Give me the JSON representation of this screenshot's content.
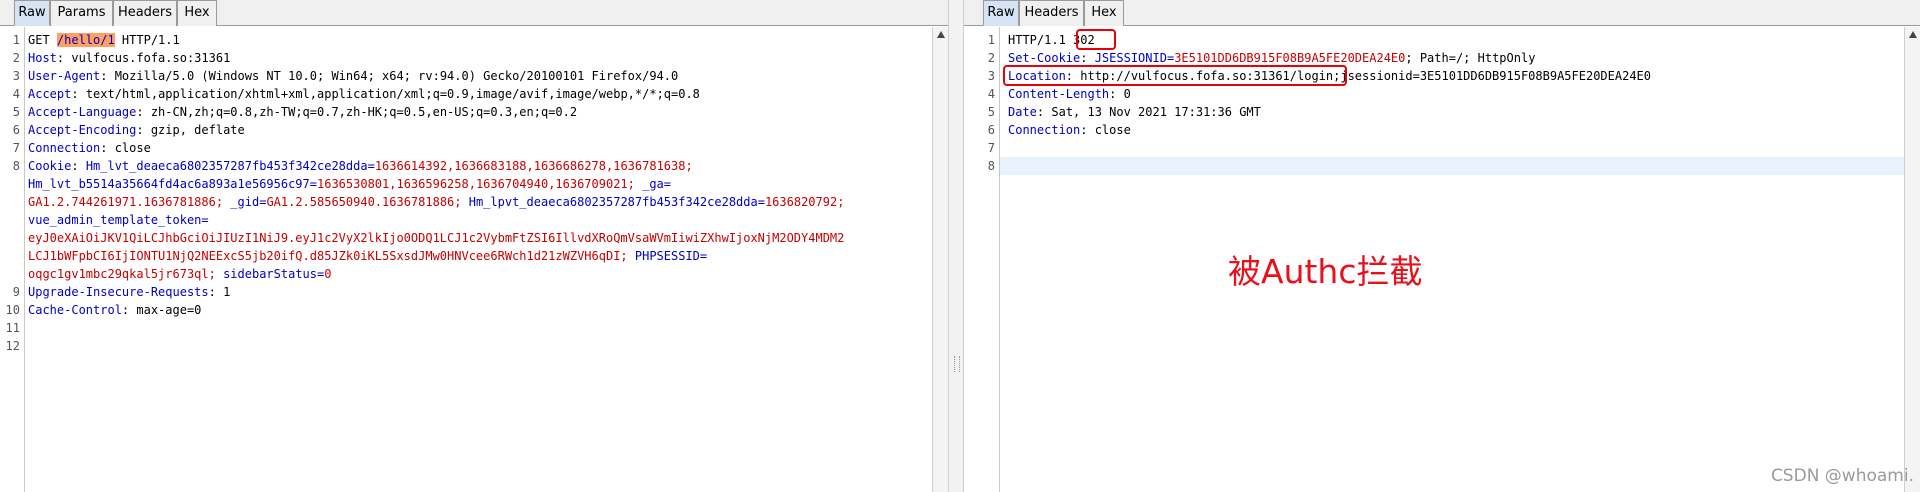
{
  "request": {
    "tabs": [
      "Raw",
      "Params",
      "Headers",
      "Hex"
    ],
    "line_numbers": [
      "1",
      "2",
      "3",
      "4",
      "5",
      "6",
      "7",
      "8",
      "",
      "",
      "",
      "",
      "",
      "",
      "9",
      "10",
      "11",
      "12"
    ],
    "line1": {
      "method": "GET ",
      "path": "/hello/1",
      "proto": " HTTP/1.1"
    },
    "headers": [
      {
        "k": "Host",
        "v": " vulfocus.fofa.so:31361"
      },
      {
        "k": "User-Agent",
        "v": " Mozilla/5.0 (Windows NT 10.0; Win64; x64; rv:94.0) Gecko/20100101 Firefox/94.0"
      },
      {
        "k": "Accept",
        "v": " text/html,application/xhtml+xml,application/xml;q=0.9,image/avif,image/webp,*/*;q=0.8"
      },
      {
        "k": "Accept-Language",
        "v": " zh-CN,zh;q=0.8,zh-TW;q=0.7,zh-HK;q=0.5,en-US;q=0.3,en;q=0.2"
      },
      {
        "k": "Accept-Encoding",
        "v": " gzip, deflate"
      },
      {
        "k": "Connection",
        "v": " close"
      }
    ],
    "cookie": {
      "label": "Cookie",
      "row1": {
        "k": "Hm_lvt_deaeca6802357287fb453f342ce28dda",
        "v": "1636614392,1636683188,1636686278,1636781638;"
      },
      "row2": {
        "k": "Hm_lvt_b5514a35664fd4ac6a893a1e56956c97",
        "v": "1636530801,1636596258,1636704940,1636709021; ",
        "k2": "_ga",
        "v2": ""
      },
      "row3": {
        "v": "GA1.2.744261971.1636781886; ",
        "k": "_gid",
        "v2": "GA1.2.585650940.1636781886; ",
        "k2": "Hm_lpvt_deaeca6802357287fb453f342ce28dda",
        "v3": "1636820792;"
      },
      "row4": {
        "k": "vue_admin_template_token"
      },
      "row5": {
        "v": "eyJ0eXAiOiJKV1QiLCJhbGciOiJIUzI1NiJ9.eyJ1c2VyX2lkIjo0ODQ1LCJ1c2VybmFtZSI6IllvdXRoQmVsaWVmIiwiZXhwIjoxNjM2ODY4MDM2"
      },
      "row6": {
        "v": "LCJ1bWFpbCI6IjIONTU1NjQ2NEExcS5jb20ifQ.d85JZk0iKL5SxsdJMw0HNVcee6RWch1d21zWZVH6qDI; ",
        "k": "PHPSESSID",
        "eq": "="
      },
      "row7": {
        "v": "oqgc1gv1mbc29qkal5jr673ql; ",
        "k": "sidebarStatus",
        "v2": "0"
      }
    },
    "tail_headers": [
      {
        "k": "Upgrade-Insecure-Requests",
        "v": " 1"
      },
      {
        "k": "Cache-Control",
        "v": " max-age=0"
      }
    ]
  },
  "response": {
    "tabs": [
      "Raw",
      "Headers",
      "Hex"
    ],
    "line_numbers": [
      "1",
      "2",
      "3",
      "4",
      "5",
      "6",
      "7",
      "8"
    ],
    "status": {
      "proto": "HTTP/1.1 ",
      "code": "302"
    },
    "set_cookie": {
      "k": "Set-Cookie",
      "ck": "JSESSIONID",
      "cv": "3E5101DD6DB915F08B9A5FE20DEA24E0",
      "rest": "; Path=/; HttpOnly"
    },
    "location": {
      "k": "Location",
      "v": " http://vulfocus.fofa.so:31361/login;",
      "rest": "jsessionid=3E5101DD6DB915F08B9A5FE20DEA24E0"
    },
    "headers": [
      {
        "k": "Content-Length",
        "v": " 0"
      },
      {
        "k": "Date",
        "v": " Sat, 13 Nov 2021 17:31:36 GMT"
      },
      {
        "k": "Connection",
        "v": " close"
      }
    ],
    "annotation": "被Authc拦截"
  },
  "watermark": "CSDN @whoami."
}
